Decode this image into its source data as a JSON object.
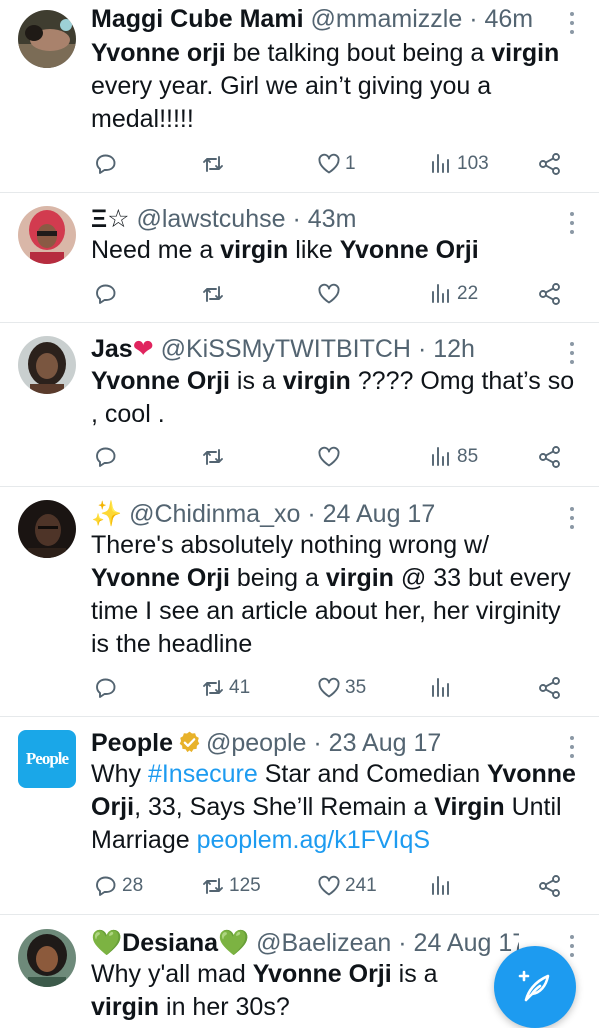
{
  "tweets": [
    {
      "name": "Maggi Cube Mami",
      "handle": "@mmamizzle",
      "time": "· 46m",
      "body": [
        {
          "t": "Yvonne orji",
          "b": true
        },
        {
          "t": " be talking bout being a "
        },
        {
          "t": "virgin",
          "b": true
        },
        {
          "t": " every year. Girl we ain’t giving you a medal!!!!!"
        }
      ],
      "replies": "",
      "retweets": "",
      "likes": "1",
      "views": "103"
    },
    {
      "name": "",
      "name_prefix": "Ξ☆",
      "handle": "@lawstcuhse",
      "time": "· 43m",
      "body": [
        {
          "t": "Need me a "
        },
        {
          "t": "virgin",
          "b": true
        },
        {
          "t": " like "
        },
        {
          "t": "Yvonne Orji",
          "b": true
        }
      ],
      "replies": "",
      "retweets": "",
      "likes": "",
      "views": "22"
    },
    {
      "name": "Jas",
      "name_suffix": "❤",
      "handle": "@KiSSMyTWITBITCH",
      "time": "· 12h",
      "body": [
        {
          "t": "Yvonne Orji",
          "b": true
        },
        {
          "t": " is a "
        },
        {
          "t": "virgin",
          "b": true
        },
        {
          "t": " ???? Omg that’s so , cool ."
        }
      ],
      "replies": "",
      "retweets": "",
      "likes": "",
      "views": "85"
    },
    {
      "name": "",
      "name_prefix": "✨",
      "handle": "@Chidinma_xo",
      "time": "· 24 Aug 17",
      "body": [
        {
          "t": "There's absolutely nothing wrong w/ "
        },
        {
          "t": "Yvonne Orji",
          "b": true
        },
        {
          "t": " being a "
        },
        {
          "t": "virgin",
          "b": true
        },
        {
          "t": " @ 33 but every time I see an article about her, her virginity is the headline"
        }
      ],
      "replies": "",
      "retweets": "41",
      "likes": "35",
      "views": ""
    },
    {
      "name": "People",
      "verified": true,
      "avatar_text": "People",
      "handle": "@people",
      "time": "· 23 Aug 17",
      "body": [
        {
          "t": "Why "
        },
        {
          "t": "#Insecure",
          "link": true
        },
        {
          "t": " Star and Comedian "
        },
        {
          "t": "Yvonne Orji",
          "b": true
        },
        {
          "t": ", 33, Says She’ll Remain a "
        },
        {
          "t": "Virgin",
          "b": true
        },
        {
          "t": " Until Marriage "
        },
        {
          "t": "peoplem.ag/k1FVIqS",
          "link": true
        }
      ],
      "replies": "28",
      "retweets": "125",
      "likes": "241",
      "views": ""
    },
    {
      "name": "Desiana",
      "name_prefix": "💚",
      "name_suffix": "💚",
      "handle": "@Baelizean",
      "time": "· 24 Aug 17",
      "body": [
        {
          "t": "Why y'all mad "
        },
        {
          "t": "Yvonne Orji",
          "b": true
        },
        {
          "t": " is a "
        },
        {
          "t": "virgin",
          "b": true
        },
        {
          "t": " in her 30s?"
        }
      ],
      "replies": "",
      "retweets": "",
      "likes": "",
      "views": ""
    }
  ],
  "icons": {
    "reply": "reply-icon",
    "retweet": "retweet-icon",
    "like": "heart-icon",
    "views": "views-icon",
    "share": "share-icon",
    "more": "more-icon",
    "compose": "compose-icon"
  },
  "colors": {
    "accent": "#1d9bf0",
    "muted": "#536471",
    "people_brand": "#1aa7e8",
    "verified_gold": "#e8b22a"
  }
}
